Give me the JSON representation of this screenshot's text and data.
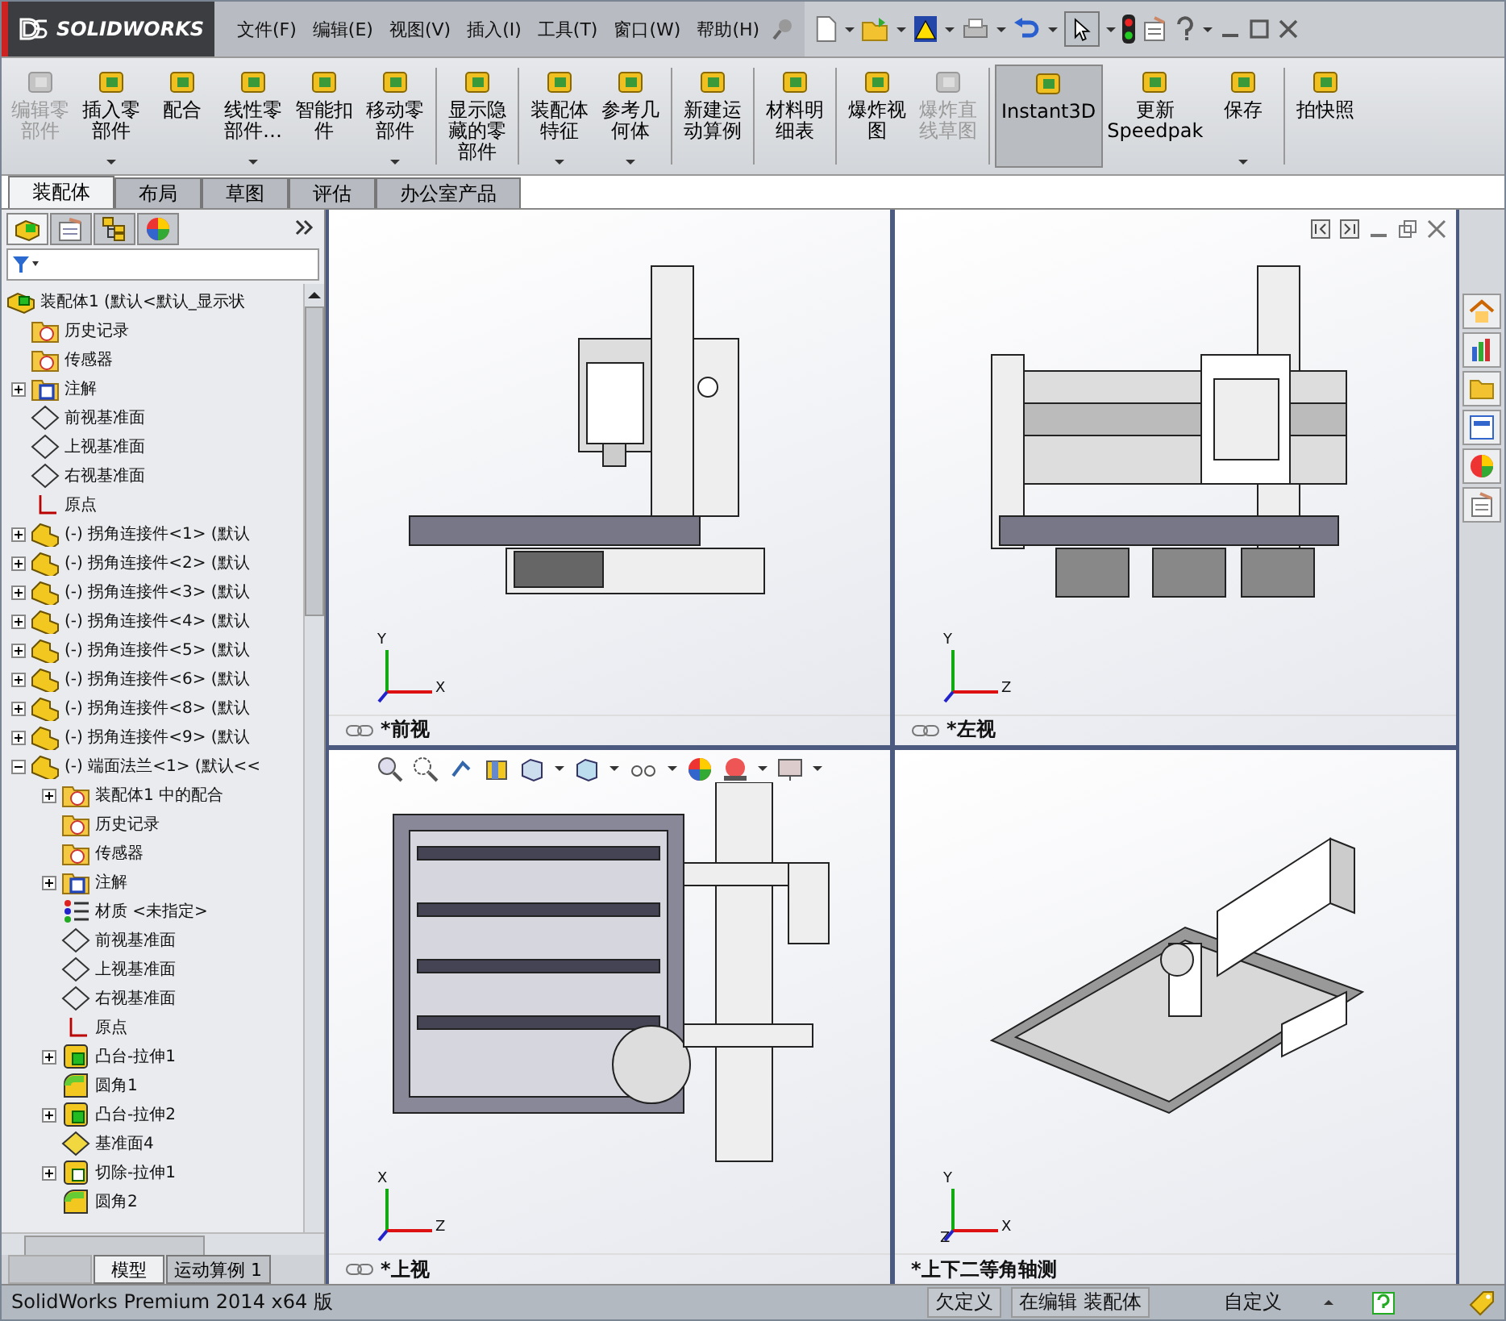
{
  "app": {
    "logo": "SOLIDWORKS"
  },
  "menu": [
    "文件(F)",
    "编辑(E)",
    "视图(V)",
    "插入(I)",
    "工具(T)",
    "窗口(W)",
    "帮助(H)"
  ],
  "ribbon_groups": [
    [
      {
        "label": "编辑零部件",
        "disabled": true,
        "dropdown": false,
        "selected": false
      },
      {
        "label": "插入零部件",
        "disabled": false,
        "dropdown": true,
        "selected": false
      },
      {
        "label": "配合",
        "disabled": false,
        "dropdown": false,
        "selected": false
      },
      {
        "label": "线性零部件…",
        "disabled": false,
        "dropdown": true,
        "selected": false
      },
      {
        "label": "智能扣件",
        "disabled": false,
        "dropdown": false,
        "selected": false
      },
      {
        "label": "移动零部件",
        "disabled": false,
        "dropdown": true,
        "selected": false
      }
    ],
    [
      {
        "label": "显示隐藏的零部件",
        "disabled": false,
        "dropdown": false,
        "selected": false
      }
    ],
    [
      {
        "label": "装配体特征",
        "disabled": false,
        "dropdown": true,
        "selected": false
      },
      {
        "label": "参考几何体",
        "disabled": false,
        "dropdown": true,
        "selected": false
      }
    ],
    [
      {
        "label": "新建运动算例",
        "disabled": false,
        "dropdown": false,
        "selected": false
      }
    ],
    [
      {
        "label": "材料明细表",
        "disabled": false,
        "dropdown": false,
        "selected": false
      }
    ],
    [
      {
        "label": "爆炸视图",
        "disabled": false,
        "dropdown": false,
        "selected": false
      },
      {
        "label": "爆炸直线草图",
        "disabled": true,
        "dropdown": false,
        "selected": false
      }
    ],
    [
      {
        "label": "Instant3D",
        "disabled": false,
        "dropdown": false,
        "selected": true
      },
      {
        "label": "更新 Speedpak",
        "disabled": false,
        "dropdown": false,
        "selected": false
      },
      {
        "label": "保存",
        "disabled": false,
        "dropdown": true,
        "selected": false
      }
    ],
    [
      {
        "label": "拍快照",
        "disabled": false,
        "dropdown": false,
        "selected": false
      }
    ]
  ],
  "tabs": [
    {
      "label": "装配体",
      "selected": true
    },
    {
      "label": "布局",
      "selected": false
    },
    {
      "label": "草图",
      "selected": false
    },
    {
      "label": "评估",
      "selected": false
    },
    {
      "label": "办公室产品",
      "selected": false
    }
  ],
  "tree": [
    {
      "label": "装配体1 (默认<默认_显示状",
      "kind": "assembly",
      "children": [
        {
          "label": "历史记录",
          "kind": "history"
        },
        {
          "label": "传感器",
          "kind": "sensor"
        },
        {
          "label": "注解",
          "kind": "annotation",
          "expanded": false
        },
        {
          "label": "前视基准面",
          "kind": "plane"
        },
        {
          "label": "上视基准面",
          "kind": "plane"
        },
        {
          "label": "右视基准面",
          "kind": "plane"
        },
        {
          "label": "原点",
          "kind": "origin"
        },
        {
          "label": "(-) 拐角连接件<1> (默认",
          "kind": "part",
          "expanded": false
        },
        {
          "label": "(-) 拐角连接件<2> (默认",
          "kind": "part",
          "expanded": false
        },
        {
          "label": "(-) 拐角连接件<3> (默认",
          "kind": "part",
          "expanded": false
        },
        {
          "label": "(-) 拐角连接件<4> (默认",
          "kind": "part",
          "expanded": false
        },
        {
          "label": "(-) 拐角连接件<5> (默认",
          "kind": "part",
          "expanded": false
        },
        {
          "label": "(-) 拐角连接件<6> (默认",
          "kind": "part",
          "expanded": false
        },
        {
          "label": "(-) 拐角连接件<8> (默认",
          "kind": "part",
          "expanded": false
        },
        {
          "label": "(-) 拐角连接件<9> (默认",
          "kind": "part",
          "expanded": false
        },
        {
          "label": "(-) 端面法兰<1> (默认<<",
          "kind": "part",
          "expanded": true,
          "children": [
            {
              "label": "装配体1 中的配合",
              "kind": "mates",
              "expanded": false
            },
            {
              "label": "历史记录",
              "kind": "history"
            },
            {
              "label": "传感器",
              "kind": "sensor"
            },
            {
              "label": "注解",
              "kind": "annotation",
              "expanded": false
            },
            {
              "label": "材质 <未指定>",
              "kind": "material"
            },
            {
              "label": "前视基准面",
              "kind": "plane"
            },
            {
              "label": "上视基准面",
              "kind": "plane"
            },
            {
              "label": "右视基准面",
              "kind": "plane"
            },
            {
              "label": "原点",
              "kind": "origin"
            },
            {
              "label": "凸台-拉伸1",
              "kind": "boss",
              "expanded": false
            },
            {
              "label": "圆角1",
              "kind": "fillet"
            },
            {
              "label": "凸台-拉伸2",
              "kind": "boss",
              "expanded": false
            },
            {
              "label": "基准面4",
              "kind": "refplane"
            },
            {
              "label": "切除-拉伸1",
              "kind": "cut",
              "expanded": false
            },
            {
              "label": "圆角2",
              "kind": "fillet"
            }
          ]
        }
      ]
    }
  ],
  "bottom_tabs": [
    {
      "label": "模型",
      "selected": true
    },
    {
      "label": "运动算例 1",
      "selected": false
    }
  ],
  "viewports": [
    {
      "label": "*前视",
      "kind": "front",
      "linked": true,
      "axes": [
        "Y",
        "X"
      ]
    },
    {
      "label": "*左视",
      "kind": "left",
      "linked": true,
      "axes": [
        "Y",
        "Z"
      ]
    },
    {
      "label": "*上视",
      "kind": "top",
      "linked": true,
      "axes": [
        "X",
        "Z"
      ]
    },
    {
      "label": "*上下二等角轴测",
      "kind": "iso",
      "linked": false,
      "axes": [
        "Y",
        "X",
        "Z"
      ]
    }
  ],
  "status_bar": {
    "product": "SolidWorks Premium 2014 x64 版",
    "state": "欠定义",
    "mode": "在编辑 装配体",
    "units": "自定义"
  }
}
